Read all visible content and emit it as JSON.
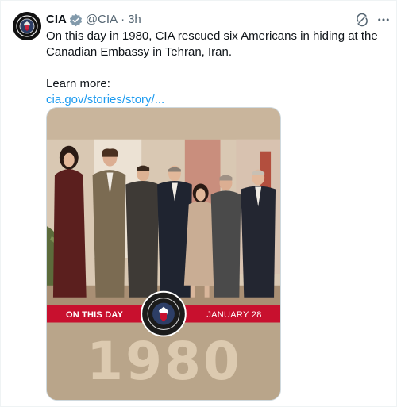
{
  "tweet": {
    "author_name": "CIA",
    "handle": "@CIA",
    "separator": "·",
    "time": "3h",
    "text_line1": "On this day in 1980, CIA rescued six Americans in hiding at the Canadian Embassy in Tehran, Iran.",
    "learn_more": "Learn more:",
    "link_text": "cia.gov/stories/story/..."
  },
  "media": {
    "banner_left": "ON THIS DAY",
    "banner_right": "JANUARY 28",
    "year": "1980"
  },
  "colors": {
    "link": "#1d9bf0",
    "verified": "#829aab",
    "banner_red": "#c8102e",
    "tan": "#b9a58a"
  },
  "icons": [
    "cia-seal-avatar-icon",
    "verified-badge-icon",
    "grok-icon",
    "more-options-icon",
    "cia-seal-icon"
  ]
}
